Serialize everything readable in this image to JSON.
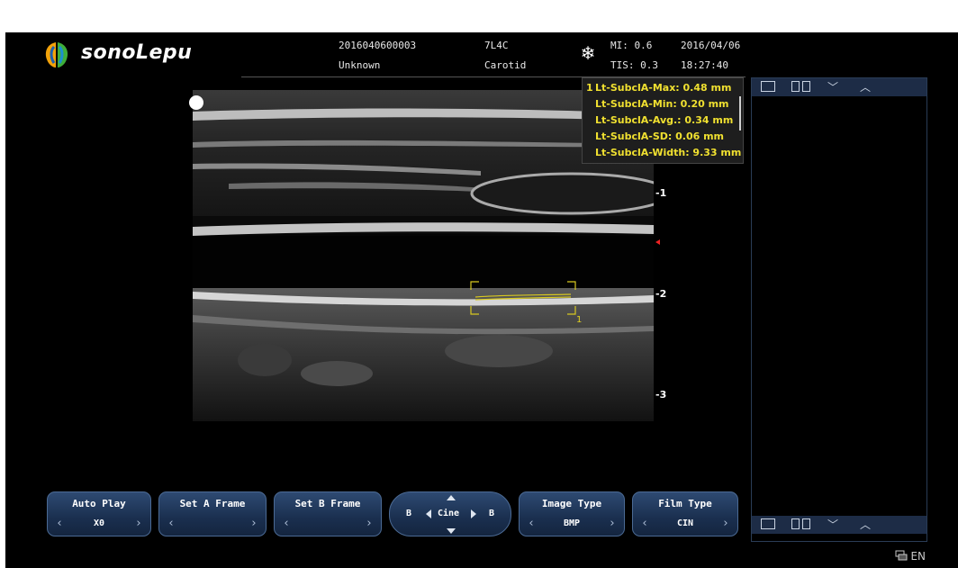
{
  "header": {
    "brand": "sonoLepu",
    "patient_id": "2016040600003",
    "patient_name": "Unknown",
    "probe": "7L4C",
    "preset": "Carotid",
    "mi": "MI: 0.6",
    "tis": "TIS: 0.3",
    "date": "2016/04/06",
    "time": "18:27:40",
    "freeze_icon": "snowflake-icon"
  },
  "depth_scale": [
    "-1",
    "-2",
    "-3"
  ],
  "measurement": {
    "index": "1",
    "rows": [
      "Lt-SubclA-Max: 0.48  mm",
      "Lt-SubclA-Min: 0.20  mm",
      "Lt-SubclA-Avg.: 0.34  mm",
      "Lt-SubclA-SD: 0.06  mm",
      "Lt-SubclA-Width: 9.33  mm"
    ],
    "roi_label": "1",
    "color": "#f0e030"
  },
  "cine": {
    "label": "Cine",
    "left": "B",
    "right": "B"
  },
  "buttons": [
    {
      "id": "auto-play",
      "label": "Auto Play",
      "value": "X0"
    },
    {
      "id": "set-a-frame",
      "label": "Set A Frame",
      "value": ""
    },
    {
      "id": "set-b-frame",
      "label": "Set B Frame",
      "value": ""
    },
    {
      "id": "image-type",
      "label": "Image Type",
      "value": "BMP"
    },
    {
      "id": "film-type",
      "label": "Film Type",
      "value": "CIN"
    }
  ],
  "language": "EN",
  "colors": {
    "panel_bar": "#1d2c46",
    "button": "#1a2f4f",
    "focus_marker": "#e22222"
  }
}
